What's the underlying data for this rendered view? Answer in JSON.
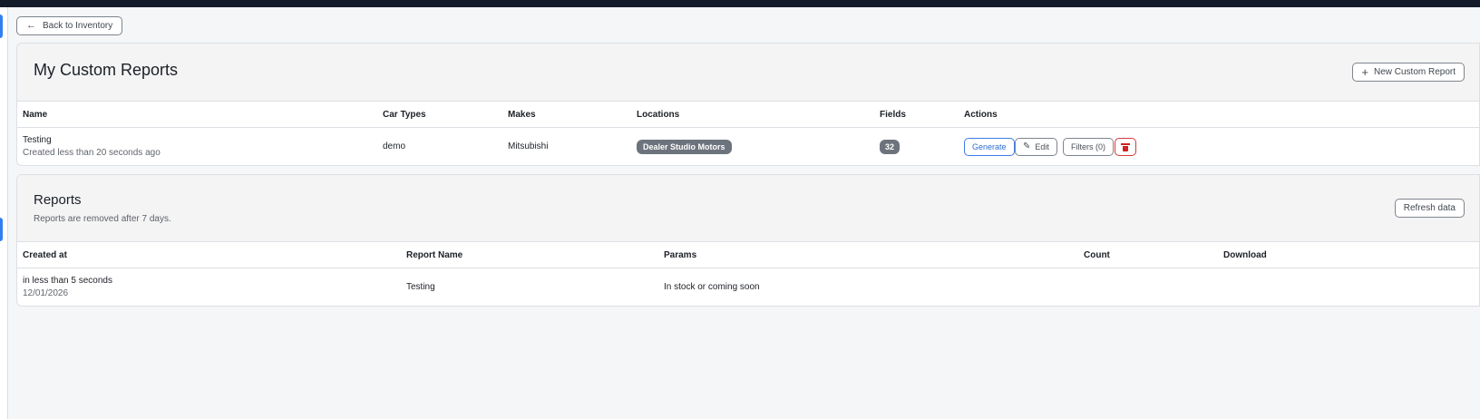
{
  "nav": {
    "back_label": "Back to Inventory"
  },
  "custom_reports": {
    "title": "My Custom Reports",
    "new_button_label": "New Custom Report",
    "columns": [
      "Name",
      "Car Types",
      "Makes",
      "Locations",
      "Fields",
      "Actions"
    ],
    "rows": [
      {
        "name": "Testing",
        "created": "Created less than 20 seconds ago",
        "car_types": "demo",
        "makes": "Mitsubishi",
        "location": "Dealer Studio Motors",
        "fields": "32",
        "actions": {
          "generate": "Generate",
          "edit": "Edit",
          "filters": "Filters (0)"
        }
      }
    ]
  },
  "reports": {
    "title": "Reports",
    "subtitle": "Reports are removed after 7 days.",
    "refresh_label": "Refresh data",
    "columns": [
      "Created at",
      "Report Name",
      "Params",
      "Count",
      "Download"
    ],
    "rows": [
      {
        "created_relative": "in less than 5 seconds",
        "created_date": "12/01/2026",
        "report_name": "Testing",
        "params": "In stock or coming soon",
        "count": "",
        "download": ""
      }
    ]
  },
  "colors": {
    "accent_blue": "#2f7ff0",
    "danger_red": "#d11f1f",
    "topbar": "#141b2b",
    "badge_gray": "#6c737c"
  },
  "icons": [
    "arrow-left-icon",
    "plus-icon",
    "edit-icon",
    "trash-icon"
  ]
}
